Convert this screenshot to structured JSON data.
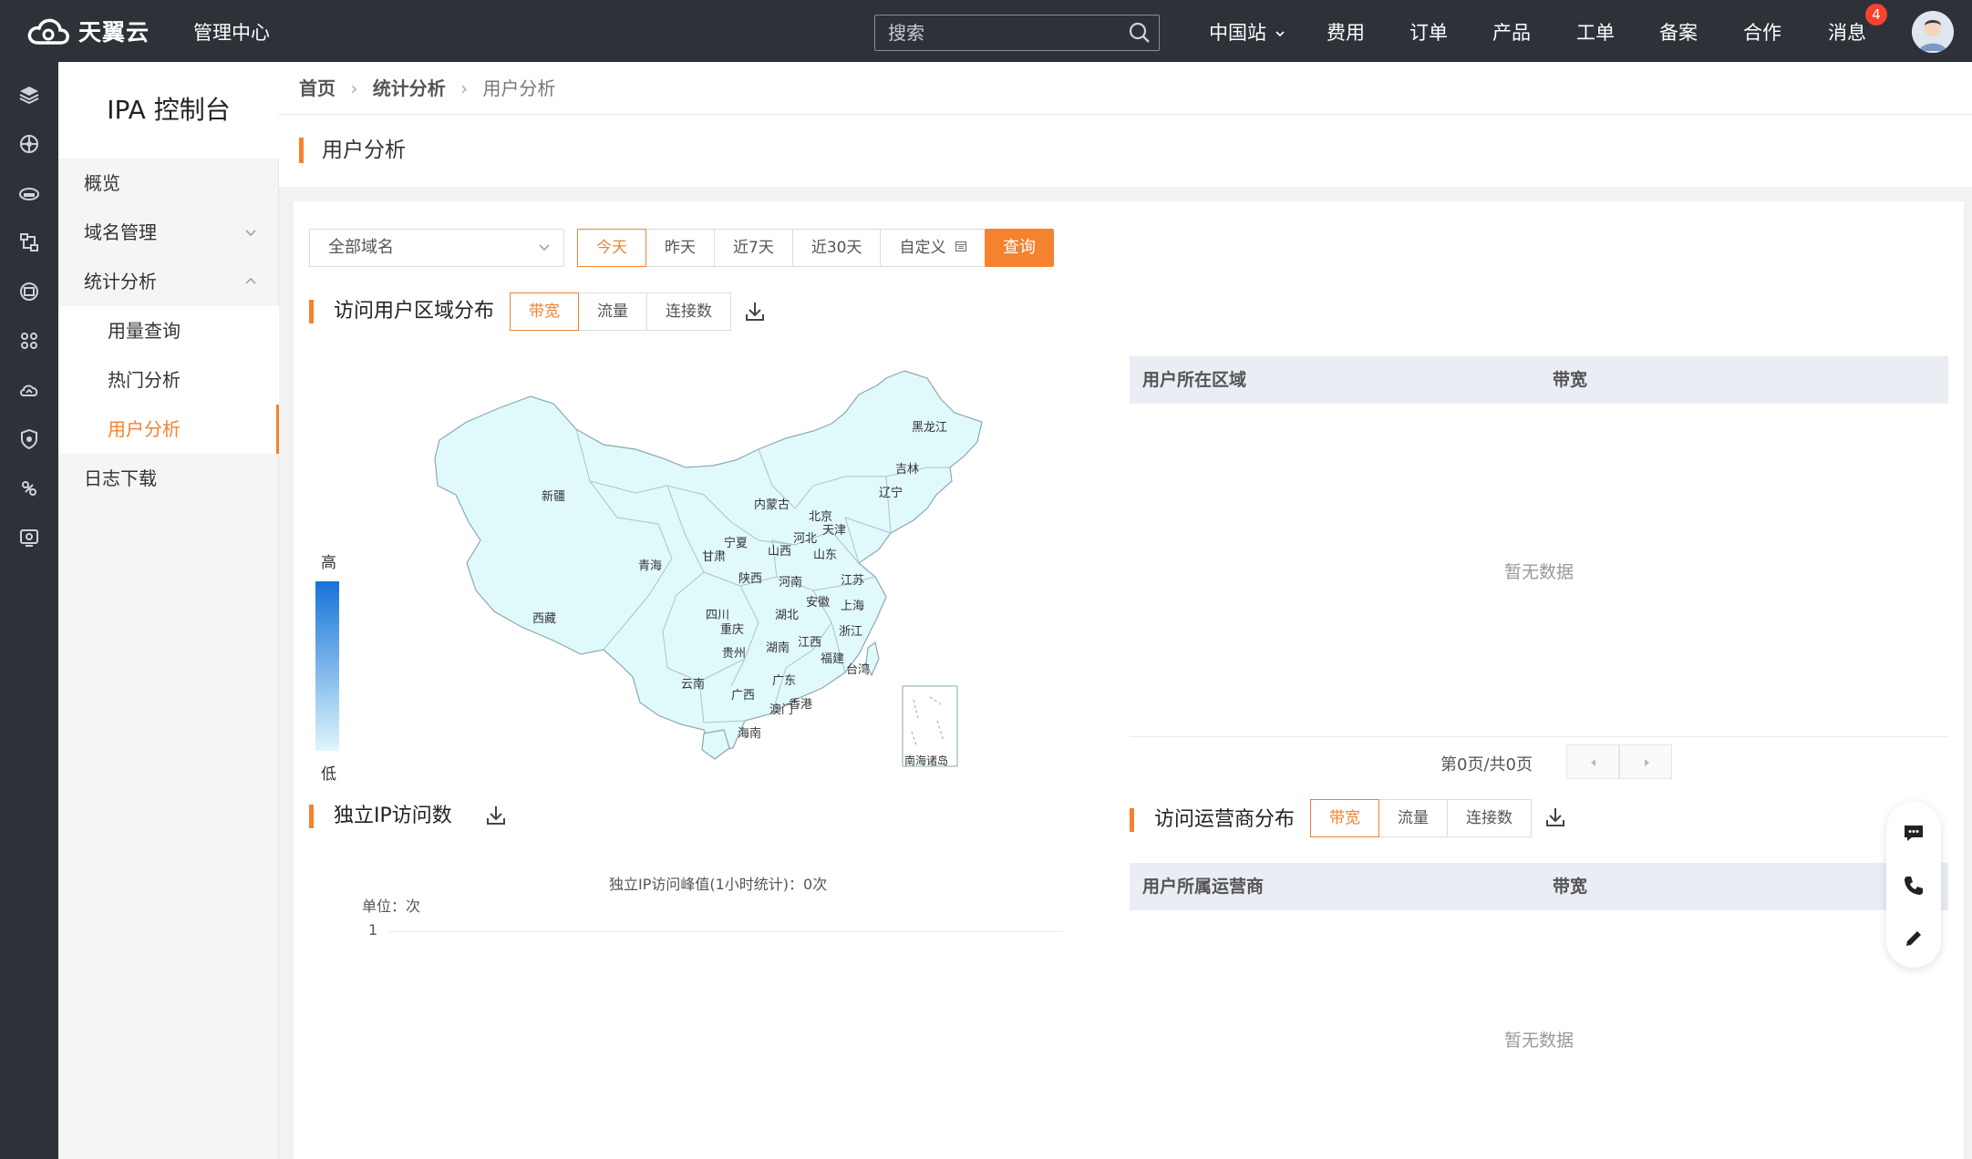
{
  "topbar": {
    "brand": "天翼云",
    "center": "管理中心",
    "search_placeholder": "搜索",
    "nav": [
      "中国站",
      "费用",
      "订单",
      "产品",
      "工单",
      "备案",
      "合作",
      "消息"
    ],
    "message_count": "4"
  },
  "rail": [
    "layers-icon",
    "network-icon",
    "cloud-drive-icon",
    "topology-icon",
    "database-icon",
    "cluster-icon",
    "cloud-sync-icon",
    "shield-icon",
    "link-icon",
    "monitor-icon"
  ],
  "sidemenu": {
    "title": "IPA 控制台",
    "items": [
      "概览",
      "域名管理",
      "统计分析",
      "用量查询",
      "热门分析",
      "用户分析",
      "日志下载"
    ]
  },
  "breadcrumb": [
    "首页",
    "统计分析",
    "用户分析"
  ],
  "page_title": "用户分析",
  "filters": {
    "domain_select": "全部域名",
    "ranges": [
      "今天",
      "昨天",
      "近7天",
      "近30天",
      "自定义"
    ],
    "active_range": 0,
    "query": "查询"
  },
  "region": {
    "title": "访问用户区域分布",
    "tabs": [
      "带宽",
      "流量",
      "连接数"
    ],
    "legend_high": "高",
    "legend_low": "低",
    "provinces": [
      "黑龙江",
      "吉林",
      "辽宁",
      "内蒙古",
      "北京",
      "天津",
      "河北",
      "山西",
      "山东",
      "新疆",
      "宁夏",
      "甘肃",
      "青海",
      "陕西",
      "河南",
      "江苏",
      "安徽",
      "上海",
      "西藏",
      "四川",
      "重庆",
      "湖北",
      "浙江",
      "江西",
      "湖南",
      "贵州",
      "福建",
      "台湾",
      "云南",
      "广西",
      "广东",
      "香港",
      "澳门",
      "海南",
      "南海诸岛"
    ],
    "table_headers": [
      "用户所在区域",
      "带宽"
    ],
    "empty": "暂无数据",
    "pager": "第0页/共0页"
  },
  "ip": {
    "title": "独立IP访问数",
    "caption": "独立IP访问峰值(1小时统计)：0次",
    "unit": "单位：次",
    "y_tick": "1"
  },
  "isp": {
    "title": "访问运营商分布",
    "tabs": [
      "带宽",
      "流量",
      "连接数"
    ],
    "table_headers": [
      "用户所属运营商",
      "带宽"
    ],
    "empty": "暂无数据"
  },
  "float_tools": [
    "chat-icon",
    "phone-icon",
    "edit-icon"
  ],
  "colors": {
    "accent": "#f4822f",
    "topbar": "#2e3138",
    "map_fill": "#e0f9fb",
    "badge": "#f5432e"
  }
}
